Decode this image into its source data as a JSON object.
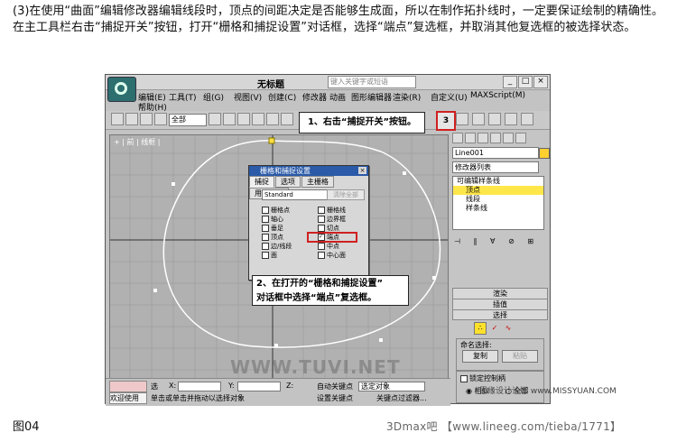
{
  "intro_text": "(3)在使用“曲面”编辑修改器编辑线段时，顶点的间距决定是否能够生成面，所以在制作拓扑线时，一定要保证绘制的精确性。在主工具栏右击“捕捉开关”按钮，打开“栅格和捕捉设置”对话框，选择“端点”复选框，并取消其他复选框的被选择状态。",
  "figure_label": "图04",
  "bottom_watermark": "3Dmax吧 【www.lineeg.com/tieba/1771】",
  "app": {
    "title": "无标题",
    "search_placeholder": "键入关键字或短语",
    "menu": [
      "编辑(E)",
      "工具(T)",
      "组(G)",
      "视图(V)",
      "创建(C)",
      "修改器",
      "动画",
      "图形编辑器",
      "渲染(R)",
      "自定义(U)",
      "MAXScript(M)",
      "帮助(H)"
    ],
    "select_filter": "全部",
    "snap_button_label": "3",
    "viewport_label": "+ | 前 | 线框 |",
    "watermark_mid": "WWW.TUVI.NET",
    "watermark_right": "思缘设计论坛 www.MISSYUAN.COM"
  },
  "callouts": {
    "step1": "1、右击“捕捉开关”按钮。",
    "step2_line1": "2、在打开的“栅格和捕捉设置”",
    "step2_line2": "对话框中选择“端点”复选框。"
  },
  "dialog": {
    "title": "栅格和捕捉设置",
    "tabs": [
      "捕捉",
      "选项",
      "主栅格",
      "用户栅格"
    ],
    "preset": "Standard",
    "clear_all": "清除全部",
    "snaps": [
      {
        "left": "栅格点",
        "right": "栅格线"
      },
      {
        "left": "轴心",
        "right": "边界框"
      },
      {
        "left": "垂足",
        "right": "切点"
      },
      {
        "left": "顶点",
        "right": "端点"
      },
      {
        "left": "边/线段",
        "right": "中点"
      },
      {
        "left": "面",
        "right": "中心面"
      }
    ]
  },
  "command_panel": {
    "object_name": "Line001",
    "object_color": "#ffd030",
    "modifier_list": "修改器列表",
    "stack": [
      "可编辑样条线",
      "顶点",
      "线段",
      "样条线"
    ],
    "rollouts": [
      "渲染",
      "插值",
      "选择"
    ],
    "named_selections": "命名选择:",
    "copy": "复制",
    "paste": "粘贴",
    "lock_handles": "锁定控制柄",
    "similar": "相似",
    "all": "全部"
  },
  "status": {
    "welcome": "欢迎使用",
    "select_label": "选",
    "x_label": "X:",
    "y_label": "Y:",
    "z_label": "Z:",
    "hint": "单击或单击并拖动以选择对象",
    "auto_key": "自动关键点",
    "set_key": "设置关键点",
    "filter": "选定对象",
    "key_filters": "关键点过滤器..."
  }
}
